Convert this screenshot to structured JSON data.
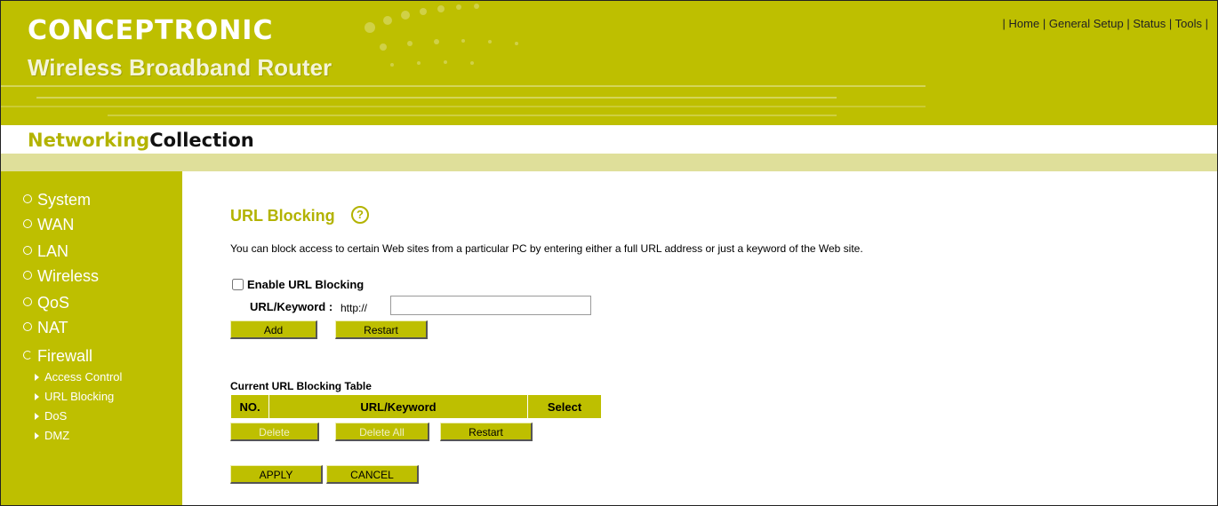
{
  "header": {
    "logo": "CONCEPTRONIC",
    "subtitle": "Wireless Broadband Router",
    "topnav": {
      "sep": "|",
      "items": [
        "Home",
        "General Setup",
        "Status",
        "Tools"
      ]
    }
  },
  "collection": {
    "part1": "Networking",
    "part2": "Collection"
  },
  "sidebar": {
    "items": [
      "System",
      "WAN",
      "LAN",
      "Wireless",
      "QoS",
      "NAT",
      "Firewall"
    ],
    "subitems": [
      "Access Control",
      "URL Blocking",
      "DoS",
      "DMZ"
    ]
  },
  "page": {
    "title": "URL Blocking",
    "description": "You can block access to certain Web sites from a particular PC by entering either a full URL address or just a keyword of the Web site.",
    "enable_label": "Enable URL Blocking",
    "enable_checked": false,
    "url_label": "URL/Keyword :",
    "url_prefix": "http://",
    "url_value": "",
    "add_label": "Add",
    "restart_label": "Restart",
    "table_title": "Current URL Blocking Table",
    "table_headers": [
      "NO.",
      "URL/Keyword",
      "Select"
    ],
    "delete_label": "Delete",
    "delete_all_label": "Delete All",
    "restart2_label": "Restart",
    "apply_label": "APPLY",
    "cancel_label": "CANCEL"
  },
  "colors": {
    "brand": "#bebf00",
    "band": "#dfdf9a",
    "title": "#b3b300"
  },
  "icons": [
    "help-icon",
    "radio-bullet-icon",
    "triangle-bullet-icon"
  ]
}
